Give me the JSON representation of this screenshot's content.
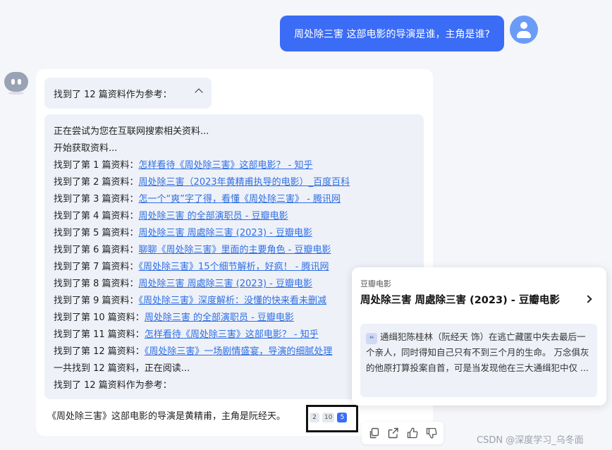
{
  "user_message": "周处除三害 这部电影的导演是谁，主角是谁?",
  "found_header": "找到了 12 篇资料作为参考：",
  "log": {
    "searching": "正在尝试为您在互联网搜索相关资料...",
    "start": "开始获取资料...",
    "items": [
      {
        "prefix": "找到了第 1 篇资料：",
        "link": "怎样看待《周处除三害》这部电影？ - 知乎"
      },
      {
        "prefix": "找到了第 2 篇资料：",
        "link": "周处除三害（2023年黄精甫执导的电影）_百度百科"
      },
      {
        "prefix": "找到了第 3 篇资料：",
        "link": "怎一个“爽”字了得，看懂《周处除三害》 - 腾讯网"
      },
      {
        "prefix": "找到了第 4 篇资料：",
        "link": "周处除三害 的全部演职员 - 豆瓣电影"
      },
      {
        "prefix": "找到了第 5 篇资料：",
        "link": "周处除三害 周處除三害 (2023) - 豆瓣电影"
      },
      {
        "prefix": "找到了第 6 篇资料：",
        "link": "聊聊《周处除三害》里面的主要角色 - 豆瓣电影"
      },
      {
        "prefix": "找到了第 7 篇资料：",
        "link": "《周处除三害》15个细节解析，好疯！ - 腾讯网"
      },
      {
        "prefix": "找到了第 8 篇资料：",
        "link": "周处除三害 周處除三害 (2023) - 豆瓣电影"
      },
      {
        "prefix": "找到了第 9 篇资料：",
        "link": "《周处除三害》深度解析：没懂的快来看未删减"
      },
      {
        "prefix": "找到了第 10 篇资料：",
        "link": "周处除三害 的全部演职员 - 豆瓣电影"
      },
      {
        "prefix": "找到了第 11 篇资料：",
        "link": "怎样看待《周处除三害》这部电影？ - 知乎"
      },
      {
        "prefix": "找到了第 12 篇资料：",
        "link": "《周处除三害》一场剧情盛宴，导演的细腻处理"
      }
    ],
    "total": "一共找到 12 篇资料，正在阅读...",
    "final": "找到了 12 篇资料作为参考："
  },
  "answer": "《周处除三害》这部电影的导演是黄精甫，主角是阮经天。",
  "citations": [
    "2",
    "10",
    "5"
  ],
  "active_citation": "5",
  "popup": {
    "source": "豆瓣电影",
    "title": "周处除三害 周處除三害 (2023) - 豆瓣电影",
    "quote_icon": "❝",
    "snippet": "通缉犯陈桂林（阮经天 饰）在逃亡藏匿中失去最后一个亲人，同时得知自己只有不到三个月的生命。 万念俱灰的他原打算投案自首，可是当发现他在三大通缉犯中仅 ..."
  },
  "actions": {
    "icons": [
      "copy-icon",
      "share-icon",
      "thumbs-up-icon",
      "thumbs-down-icon"
    ]
  },
  "watermark": "CSDN @深度学习_乌冬面",
  "colors": {
    "accent": "#3b6cf6",
    "link": "#2f6fe4",
    "panel": "#eef1f8",
    "background": "#f5f6fa"
  }
}
